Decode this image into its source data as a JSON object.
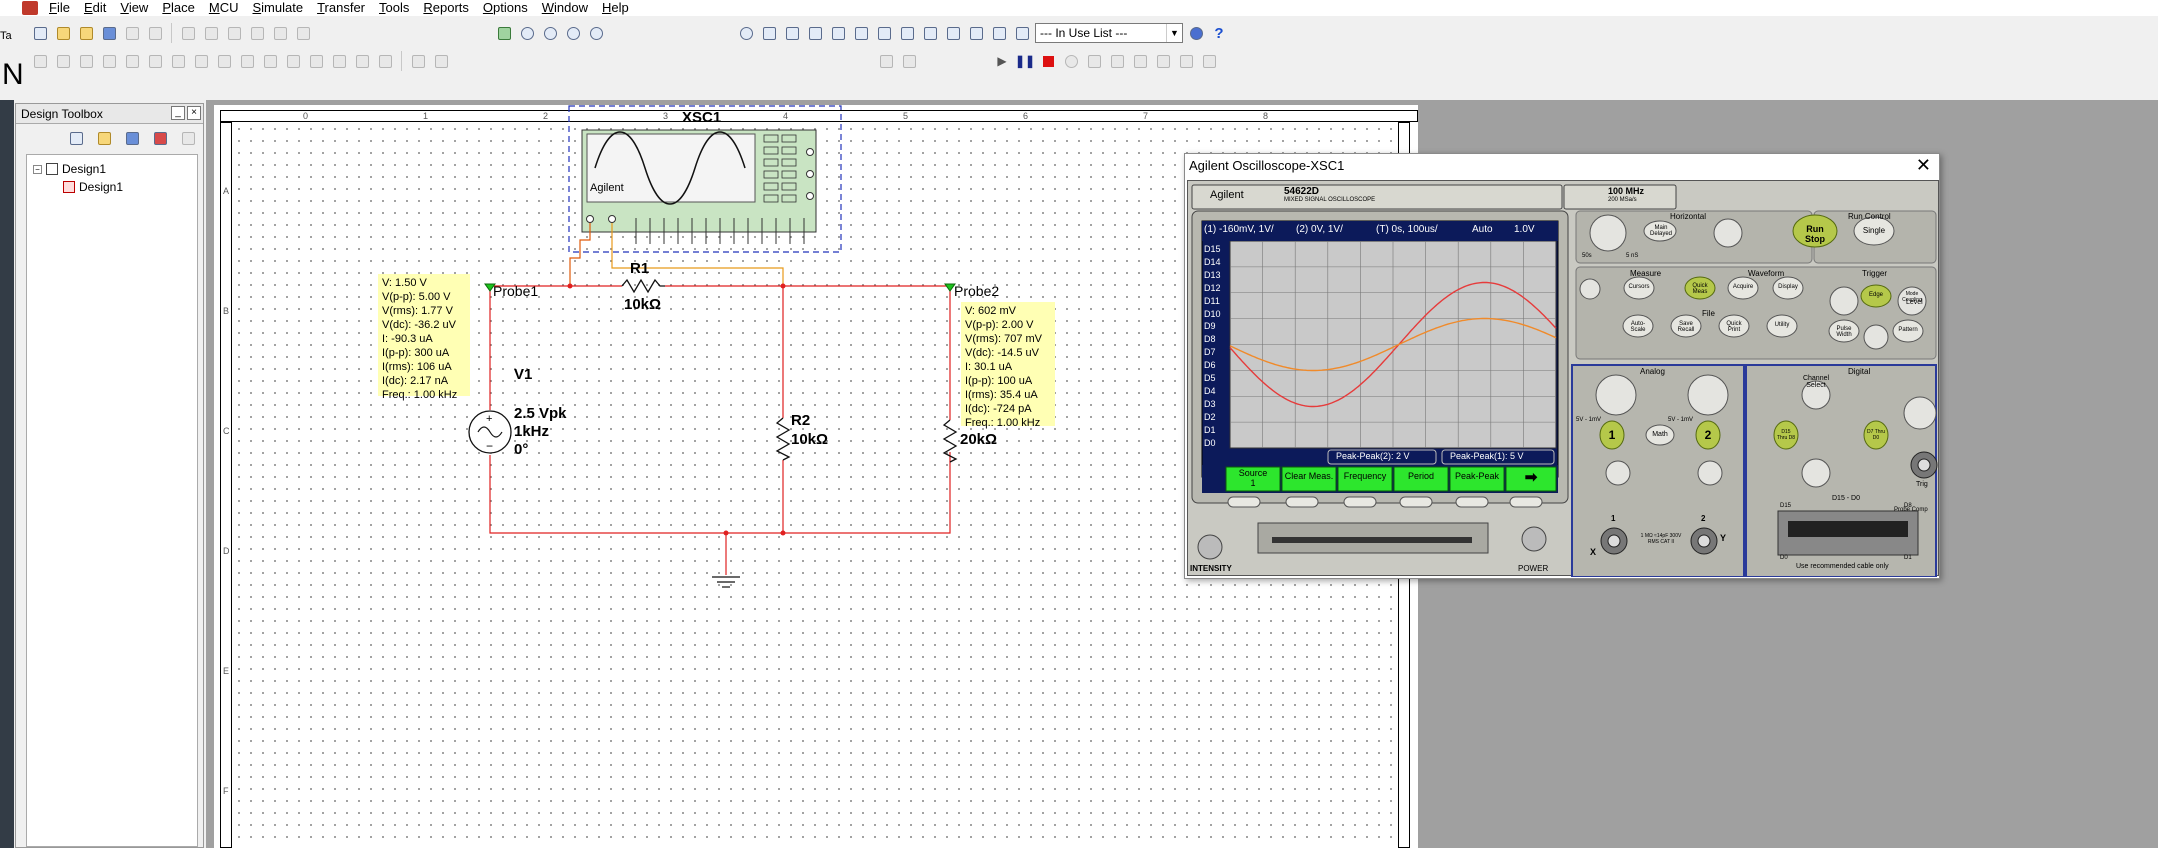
{
  "menu": [
    "File",
    "Edit",
    "View",
    "Place",
    "MCU",
    "Simulate",
    "Transfer",
    "Tools",
    "Reports",
    "Options",
    "Window",
    "Help"
  ],
  "toolbar": {
    "in_use_list": "--- In Use List ---"
  },
  "side_text": {
    "ta": "Ta",
    "n": "N"
  },
  "toolbox": {
    "title": "Design Toolbox",
    "minimize": "_",
    "close": "×",
    "tree": [
      {
        "label": "Design1",
        "level": 0
      },
      {
        "label": "Design1",
        "level": 1
      }
    ]
  },
  "sheet": {
    "cols": [
      "0",
      "1",
      "2",
      "3",
      "4",
      "5",
      "6",
      "7",
      "8"
    ],
    "rows": [
      "A",
      "B",
      "C",
      "D",
      "E",
      "F"
    ]
  },
  "circuit": {
    "instrument": {
      "ref": "XSC1",
      "brand": "Agilent"
    },
    "r1": {
      "ref": "R1",
      "value": "10kΩ"
    },
    "r2": {
      "ref": "R2",
      "value": "10kΩ"
    },
    "r3": {
      "value": "20kΩ"
    },
    "v1": {
      "ref": "V1",
      "amp": "2.5 Vpk",
      "freq": "1kHz",
      "phase": "0°"
    },
    "probe1": {
      "name": "Probe1",
      "lines": [
        "V: 1.50 V",
        "V(p-p): 5.00 V",
        "V(rms): 1.77 V",
        "V(dc): -36.2 uV",
        "I: -90.3 uA",
        "I(p-p): 300 uA",
        "I(rms): 106 uA",
        "I(dc): 2.17 nA",
        "Freq.: 1.00 kHz"
      ]
    },
    "probe2": {
      "name": "Probe2",
      "lines": [
        "V: 602 mV",
        "V(p-p): 2.00 V",
        "V(rms): 707 mV",
        "V(dc): -14.5 uV",
        "I: 30.1 uA",
        "I(p-p): 100 uA",
        "I(rms): 35.4 uA",
        "I(dc): -724 pA",
        "Freq.: 1.00 kHz"
      ]
    }
  },
  "oscilloscope": {
    "window_title": "Agilent Oscilloscope-XSC1",
    "close": "✕",
    "brand": "Agilent",
    "model": "54622D",
    "model_sub": "MIXED SIGNAL OSCILLOSCOPE",
    "bandwidth": "100 MHz",
    "sample_rate": "200 MSa/s",
    "status_ch1": "(1) -160mV, 1V/",
    "status_ch2": "(2) 0V, 1V/",
    "status_time": "(T) 0s, 100us/",
    "status_trig": "Auto",
    "status_trig_level": "1.0V",
    "digital_labels": [
      "D15",
      "D14",
      "D13",
      "D12",
      "D11",
      "D10",
      "D9",
      "D8",
      "D7",
      "D6",
      "D5",
      "D4",
      "D3",
      "D2",
      "D1",
      "D0"
    ],
    "measure1": "Peak-Peak(2): 2 V",
    "measure2": "Peak-Peak(1): 5 V",
    "softkeys": [
      "Source\n1",
      "Clear Meas.",
      "Frequency",
      "Period",
      "Peak-Peak",
      "➡"
    ],
    "sections": {
      "horizontal": "Horizontal",
      "run_control": "Run Control",
      "measure": "Measure",
      "waveform": "Waveform",
      "trigger": "Trigger",
      "file": "File",
      "analog": "Analog",
      "digital": "Digital"
    },
    "buttons": {
      "main_delayed": "Main Delayed",
      "run_stop": "Run Stop",
      "single": "Single",
      "cursors": "Cursors",
      "quick_meas": "Quick Meas",
      "acquire": "Acquire",
      "display": "Display",
      "edge": "Edge",
      "mode_coupling": "Mode Coupling",
      "auto_scale": "Auto-Scale",
      "save_recall": "Save Recall",
      "quick_print": "Quick Print",
      "utility": "Utility",
      "pulse_width": "Pulse Width",
      "pattern": "Pattern",
      "math": "Math",
      "ch1": "1",
      "ch2": "2",
      "d15_d8": "D15 Thru D8",
      "d7_d0": "D7 Thru D0",
      "level": "Level",
      "trig": "Trig",
      "probe_comp": "Probe Comp",
      "channel_select": "Channel Select",
      "d15_d0": "D15 - D0",
      "intensity": "INTENSITY",
      "power": "POWER",
      "cable_note": "Use recommended cable only",
      "label_50s": "50s",
      "label_5ns": "5 nS",
      "label_5v_1mv_a": "5V - 1mV",
      "label_5v_1mv_b": "5V - 1mV",
      "label_x": "X",
      "label_y": "Y",
      "label_1": "1",
      "label_2": "2",
      "label_imp": "1 MΩ ≈14pF 300V RMS CAT II",
      "label_d15": "D15",
      "label_d8": "D8",
      "label_d0": "D0",
      "label_d1": "D1"
    }
  }
}
